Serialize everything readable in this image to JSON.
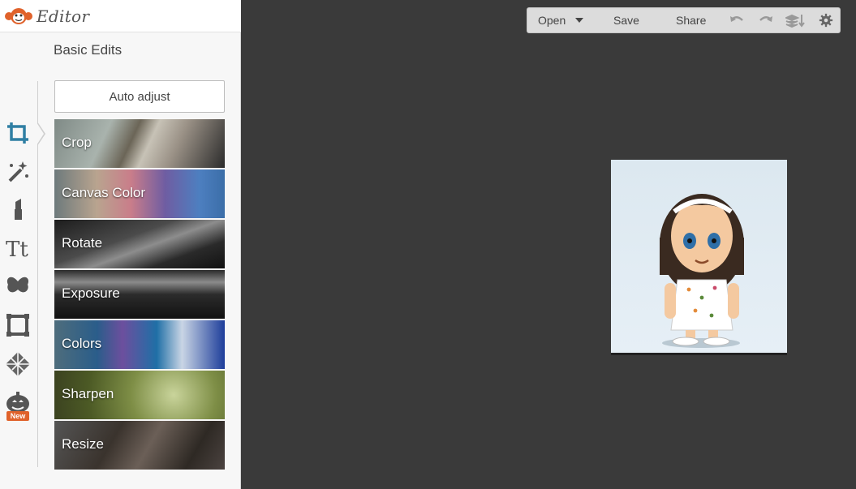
{
  "app": {
    "name": "Editor"
  },
  "sidebar": {
    "icons": [
      {
        "name": "crop-icon"
      },
      {
        "name": "magic-wand-icon"
      },
      {
        "name": "lipstick-icon"
      },
      {
        "name": "text-icon"
      },
      {
        "name": "butterfly-icon"
      },
      {
        "name": "frame-icon"
      },
      {
        "name": "texture-icon"
      },
      {
        "name": "pumpkin-icon",
        "badge": "New"
      }
    ]
  },
  "panel": {
    "title": "Basic Edits",
    "auto_adjust_label": "Auto adjust",
    "tools": [
      {
        "label": "Crop"
      },
      {
        "label": "Canvas Color"
      },
      {
        "label": "Rotate"
      },
      {
        "label": "Exposure"
      },
      {
        "label": "Colors"
      },
      {
        "label": "Sharpen"
      },
      {
        "label": "Resize"
      }
    ]
  },
  "toolbar": {
    "open_label": "Open",
    "save_label": "Save",
    "share_label": "Share"
  },
  "colors": {
    "accent": "#e0622b",
    "canvas_bg": "#3a3a3a",
    "panel_bg": "#f7f7f7"
  }
}
